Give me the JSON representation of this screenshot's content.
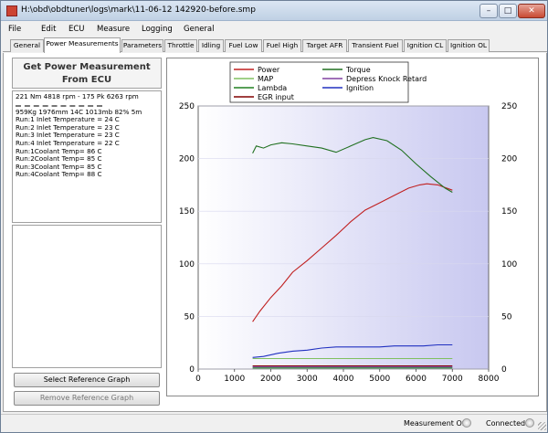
{
  "window": {
    "title": "H:\\obd\\obdtuner\\logs\\mark\\11-06-12 142920-before.smp",
    "minimize": "–",
    "maximize": "□",
    "close": "✕"
  },
  "menu": [
    "File",
    "Edit",
    "ECU",
    "Measure",
    "Logging",
    "General"
  ],
  "tabs": [
    {
      "label": "General",
      "active": false
    },
    {
      "label": "Power Measurements",
      "active": true
    },
    {
      "label": "Parameters",
      "active": false
    },
    {
      "label": "Throttle",
      "active": false
    },
    {
      "label": "Idling",
      "active": false
    },
    {
      "label": "Fuel Low",
      "active": false
    },
    {
      "label": "Fuel High",
      "active": false
    },
    {
      "label": "Target AFR",
      "active": false
    },
    {
      "label": "Transient Fuel",
      "active": false
    },
    {
      "label": "Ignition CL",
      "active": false
    },
    {
      "label": "Ignition OL",
      "active": false
    }
  ],
  "left_panel": {
    "title_line1": "Get Power Measurement",
    "title_line2": "From ECU",
    "summary": "221 Nm 4818 rpm - 175 Pk 6263 rpm",
    "info_lines": [
      "959Kg 1976mm 14C 1013mb 82% 5m",
      "Run:1 Inlet Temperature = 24 C",
      "Run:2 Inlet Temperature = 23 C",
      "Run:3 Inlet Temperature = 23 C",
      "Run:4 Inlet Temperature = 22 C",
      "Run:1Coolant Temp= 86 C",
      "Run:2Coolant Temp= 85 C",
      "Run:3Coolant Temp= 85 C",
      "Run:4Coolant Temp= 88 C"
    ],
    "select_button": "Select Reference Graph",
    "remove_button": "Remove Reference Graph"
  },
  "status": {
    "measurement": "Measurement Off",
    "connected": "Connected"
  },
  "chart_data": {
    "type": "line",
    "x_ticks": [
      "0",
      "1000",
      "2000",
      "3000",
      "4000",
      "5000",
      "6000",
      "7000",
      "8000"
    ],
    "y_ticks_left": [
      "0",
      "50",
      "100",
      "150",
      "200",
      "250"
    ],
    "y_ticks_right": [
      "0",
      "50",
      "100",
      "150",
      "200",
      "250"
    ],
    "xlim": [
      0,
      8000
    ],
    "ylim": [
      0,
      250
    ],
    "legend_position": "top",
    "series": [
      {
        "name": "Power",
        "color": "#c02020",
        "x": [
          1500,
          1700,
          2000,
          2300,
          2600,
          3000,
          3400,
          3800,
          4200,
          4600,
          5000,
          5400,
          5800,
          6100,
          6300,
          6600,
          7000
        ],
        "y": [
          45,
          55,
          68,
          79,
          92,
          103,
          115,
          127,
          140,
          151,
          158,
          165,
          172,
          175,
          176,
          175,
          170
        ]
      },
      {
        "name": "Torque",
        "color": "#207020",
        "x": [
          1500,
          1600,
          1800,
          2000,
          2300,
          2600,
          3000,
          3400,
          3800,
          4200,
          4600,
          4818,
          5200,
          5600,
          6000,
          6400,
          6800,
          7000
        ],
        "y": [
          205,
          212,
          210,
          213,
          215,
          214,
          212,
          210,
          206,
          212,
          218,
          220,
          217,
          208,
          195,
          183,
          172,
          168
        ]
      },
      {
        "name": "MAP",
        "color": "#80c060",
        "x": [
          1500,
          2000,
          3000,
          4000,
          5000,
          6000,
          7000
        ],
        "y": [
          10,
          10,
          10,
          10,
          10,
          10,
          10
        ]
      },
      {
        "name": "Depress Knock Retard",
        "color": "#8040a0",
        "x": [
          1500,
          7000
        ],
        "y": [
          2,
          2
        ]
      },
      {
        "name": "Lambda",
        "color": "#208020",
        "x": [
          1500,
          7000
        ],
        "y": [
          1,
          1
        ]
      },
      {
        "name": "Ignition",
        "color": "#2030c0",
        "x": [
          1500,
          1800,
          2200,
          2600,
          3000,
          3400,
          3800,
          4200,
          4600,
          5000,
          5400,
          5800,
          6200,
          6600,
          7000
        ],
        "y": [
          11,
          12,
          15,
          17,
          18,
          20,
          21,
          21,
          21,
          21,
          22,
          22,
          22,
          23,
          23
        ]
      },
      {
        "name": "EGR input",
        "color": "#800000",
        "x": [
          1500,
          7000
        ],
        "y": [
          3,
          3
        ]
      }
    ]
  }
}
